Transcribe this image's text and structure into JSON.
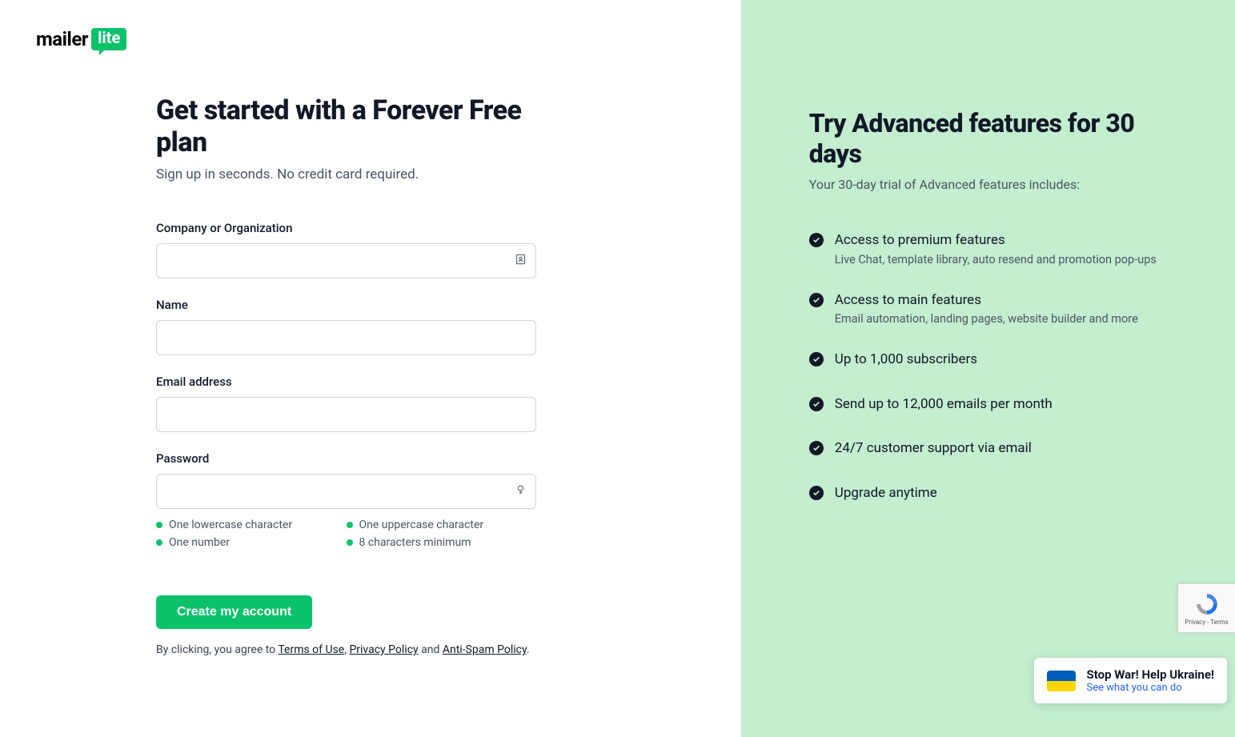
{
  "logo": {
    "mailer": "mailer",
    "lite": "lite"
  },
  "form": {
    "heading": "Get started with a Forever Free plan",
    "subheading": "Sign up in seconds. No credit card required.",
    "labels": {
      "company": "Company or Organization",
      "name": "Name",
      "email": "Email address",
      "password": "Password"
    },
    "password_reqs": {
      "lowercase": "One lowercase character",
      "uppercase": "One uppercase character",
      "number": "One number",
      "minchars": "8 characters minimum"
    },
    "submit": "Create my account",
    "terms_prefix": "By clicking, you agree to ",
    "terms_of_use": "Terms of Use",
    "terms_sep1": ", ",
    "privacy_policy": "Privacy Policy",
    "terms_sep2": " and ",
    "antispam_policy": "Anti-Spam Policy",
    "terms_suffix": "."
  },
  "right": {
    "heading": "Try Advanced features for 30 days",
    "subheading": "Your 30-day trial of Advanced features includes:",
    "features": [
      {
        "title": "Access to premium features",
        "desc": "Live Chat, template library, auto resend and promotion pop-ups"
      },
      {
        "title": "Access to main features",
        "desc": "Email automation, landing pages, website builder and more"
      },
      {
        "title": "Up to 1,000 subscribers",
        "desc": ""
      },
      {
        "title": "Send up to 12,000 emails per month",
        "desc": ""
      },
      {
        "title": "24/7 customer support via email",
        "desc": ""
      },
      {
        "title": "Upgrade anytime",
        "desc": ""
      }
    ]
  },
  "recaptcha": {
    "privacy": "Privacy",
    "dash": " - ",
    "terms": "Terms"
  },
  "ukraine": {
    "title": "Stop War! Help Ukraine!",
    "link": "See what you can do"
  }
}
